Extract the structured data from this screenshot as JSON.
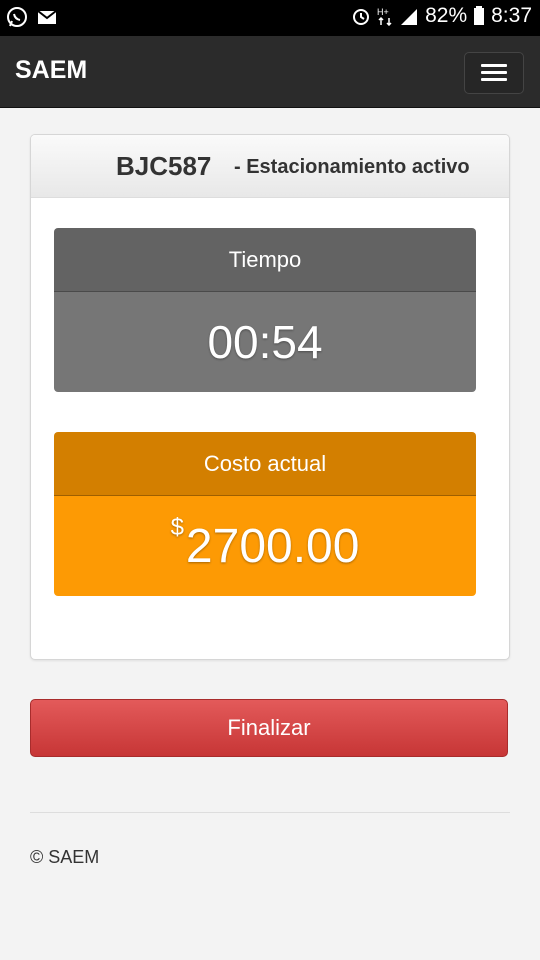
{
  "status_bar": {
    "battery": "82%",
    "time": "8:37",
    "icons": [
      "whatsapp-icon",
      "mail-icon",
      "alarm-icon",
      "data-icon",
      "signal-icon",
      "battery-icon"
    ]
  },
  "navbar": {
    "brand": "SAEM",
    "menu_icon": "hamburger-icon"
  },
  "parking": {
    "plate": "BJC587",
    "status": "- Estacionamiento activo",
    "time_label": "Tiempo",
    "time_value": "00:54",
    "cost_label": "Costo actual",
    "currency": "$",
    "cost_value": "2700.00"
  },
  "actions": {
    "finish_label": "Finalizar"
  },
  "footer": {
    "text": "© SAEM"
  },
  "colors": {
    "navbar": "#2b2b2b",
    "time_header": "#636363",
    "time_body": "#767676",
    "cost_header": "#d37f00",
    "cost_body": "#fd9a04",
    "finish_button": "#d24444"
  }
}
